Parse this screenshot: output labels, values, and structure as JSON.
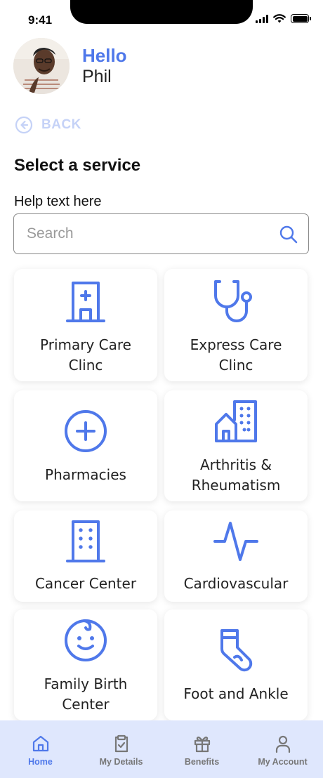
{
  "status_bar": {
    "time": "9:41"
  },
  "header": {
    "hello": "Hello",
    "user_name": "Phil"
  },
  "back": {
    "label": "BACK"
  },
  "page": {
    "title": "Select a service",
    "help_text": "Help text here"
  },
  "search": {
    "placeholder": "Search",
    "value": ""
  },
  "services": [
    {
      "label_line1": "Primary Care",
      "label_line2": "Clinc",
      "icon": "hospital-icon"
    },
    {
      "label_line1": "Express Care",
      "label_line2": "Clinc",
      "icon": "stethoscope-icon"
    },
    {
      "label_line1": "Pharmacies",
      "label_line2": "",
      "icon": "plus-circle-icon"
    },
    {
      "label_line1": "Arthritis &",
      "label_line2": "Rheumatism",
      "icon": "buildings-icon"
    },
    {
      "label_line1": "Cancer Center",
      "label_line2": "",
      "icon": "building-icon"
    },
    {
      "label_line1": "Cardiovascular",
      "label_line2": "",
      "icon": "heartbeat-icon"
    },
    {
      "label_line1": "Family Birth",
      "label_line2": "Center",
      "icon": "baby-face-icon"
    },
    {
      "label_line1": "Foot and Ankle",
      "label_line2": "",
      "icon": "sock-icon"
    }
  ],
  "bottom_nav": [
    {
      "label": "Home",
      "icon": "home-icon",
      "active": true
    },
    {
      "label": "My Details",
      "icon": "clipboard-check-icon",
      "active": false
    },
    {
      "label": "Benefits",
      "icon": "gift-icon",
      "active": false
    },
    {
      "label": "My Account",
      "icon": "user-icon",
      "active": false
    }
  ],
  "colors": {
    "accent": "#4f78ea",
    "back_disabled": "#c5d2f7",
    "nav_bg": "#dfe7fd",
    "nav_inactive": "#777777"
  }
}
